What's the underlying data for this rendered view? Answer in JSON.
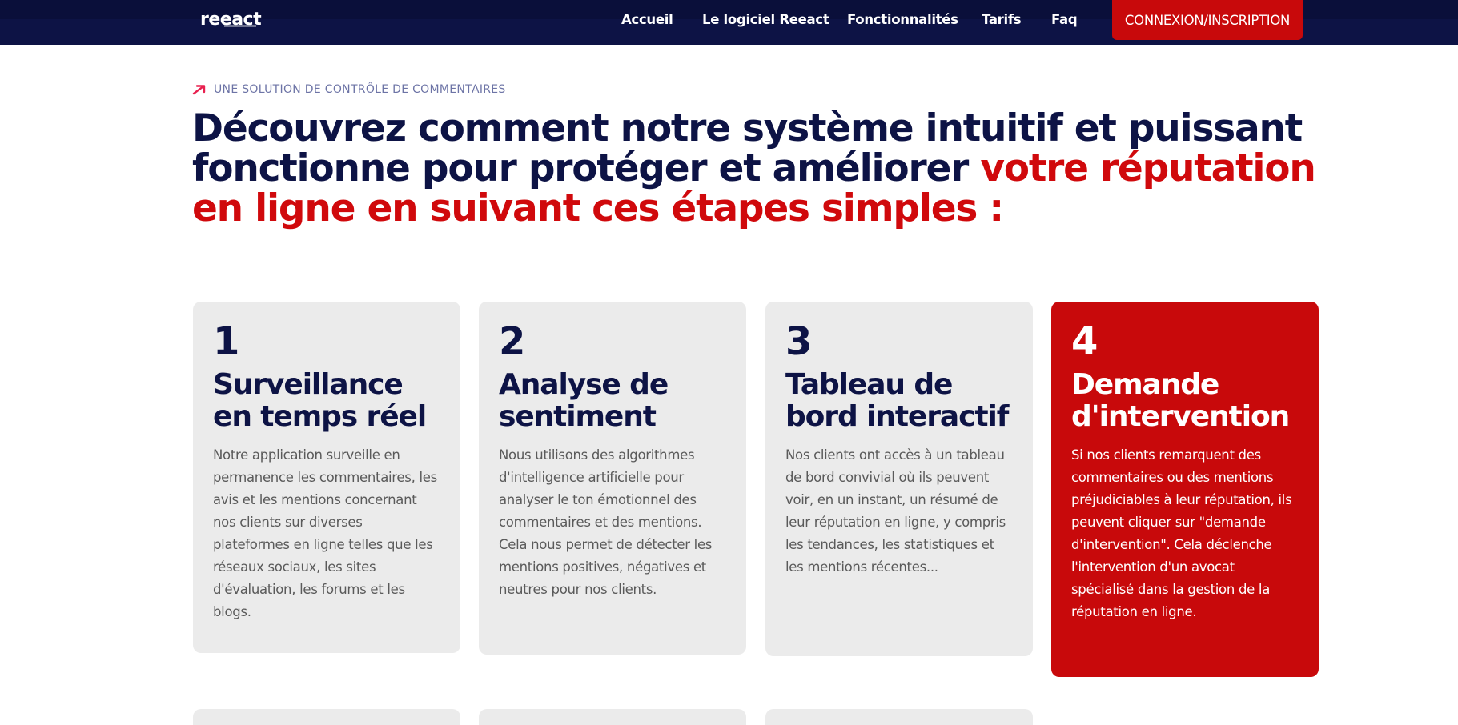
{
  "nav": {
    "logo": "reeact",
    "links": [
      "Accueil",
      "Le logiciel Reeact",
      "Fonctionnalités",
      "Tarifs",
      "Faq"
    ],
    "cta": "CONNEXION/INSCRIPTION"
  },
  "hero": {
    "eyebrow": "UNE SOLUTION DE CONTRÔLE DE COMMENTAIRES",
    "headline_part1": "Découvrez comment notre système intuitif et puissant fonctionne pour protéger et améliorer ",
    "headline_part2": "votre réputation en ligne en suivant ces étapes simples :"
  },
  "cards": [
    {
      "number": "1",
      "title": "Surveillance en temps réel",
      "description": "Notre application surveille en permanence les commentaires, les avis et les mentions concernant nos clients sur diverses plateformes en ligne telles que les réseaux sociaux, les sites d'évaluation, les forums et les blogs."
    },
    {
      "number": "2",
      "title": "Analyse de sentiment",
      "description": "Nous utilisons des algorithmes d'intelligence artificielle pour analyser le ton émotionnel des commentaires et des mentions. Cela nous permet de détecter les mentions positives, négatives et neutres pour nos clients."
    },
    {
      "number": "3",
      "title": "Tableau de bord interactif",
      "description": "Nos clients ont accès à un tableau de bord convivial où ils peuvent voir, en un instant, un résumé de leur réputation en ligne, y compris les tendances, les statistiques et les mentions récentes..."
    },
    {
      "number": "4",
      "title": "Demande d'intervention",
      "description": "Si nos clients remarquent des commentaires ou des mentions préjudiciables à leur réputation, ils peuvent cliquer sur \"demande d'intervention\". Cela déclenche l'intervention d'un avocat spécialisé dans la gestion de la réputation en ligne."
    }
  ],
  "colors": {
    "navy": "#0d1345",
    "red": "#c8090b",
    "card_gray": "#ebebeb"
  }
}
